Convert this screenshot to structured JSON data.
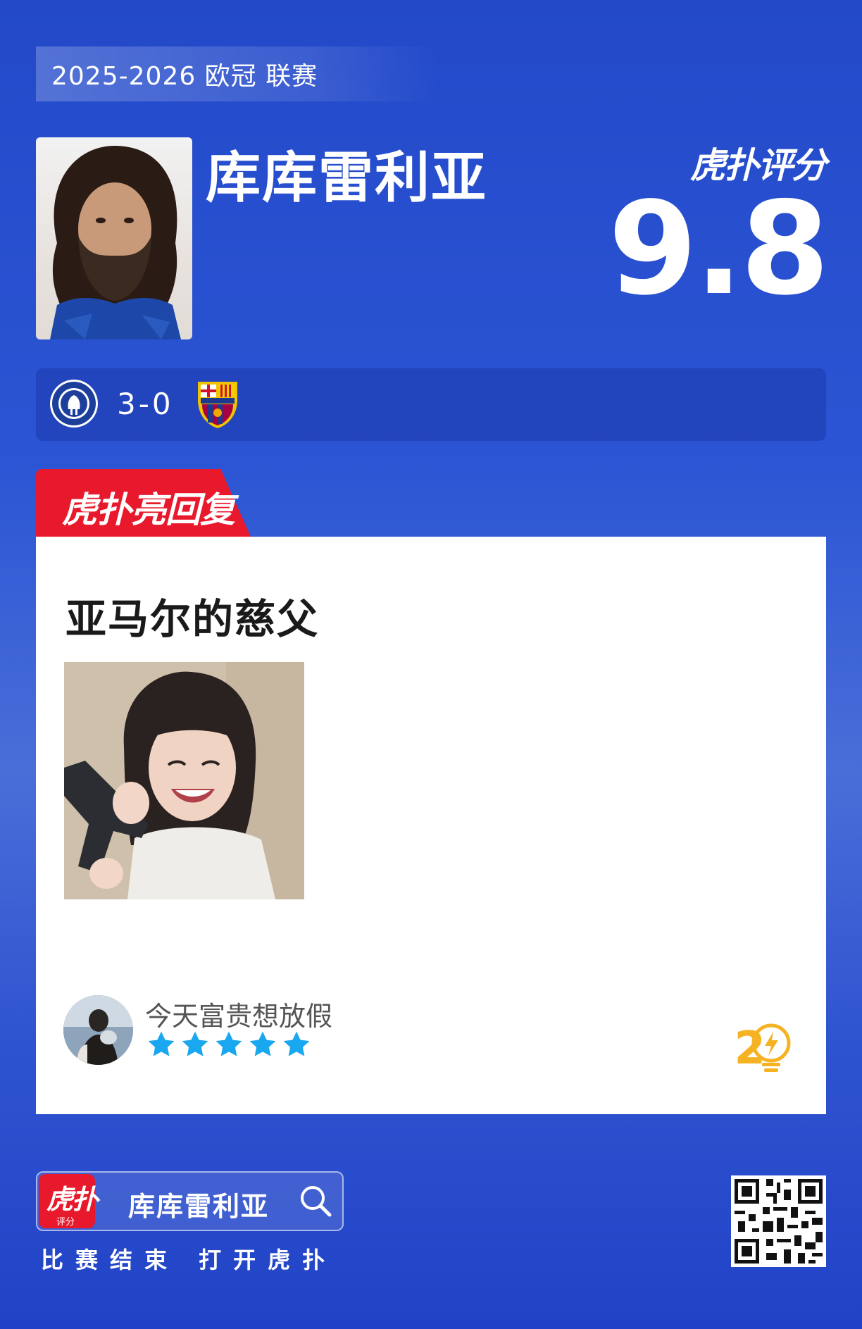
{
  "header": {
    "season_label": "2025-2026 欧冠 联赛"
  },
  "player": {
    "name": "库库雷利亚"
  },
  "rating": {
    "brand": "虎扑评分",
    "score": "9.8"
  },
  "match": {
    "score": "3-0",
    "home_team_icon": "chelsea-crest",
    "away_team_icon": "barcelona-crest"
  },
  "highlight_tag": {
    "label": "虎扑亮回复"
  },
  "reply": {
    "text": "亚马尔的慈父",
    "username": "今天富贵想放假",
    "stars": 5,
    "likes": "2",
    "star_color": "#19a7ef",
    "likes_color": "#f5b324"
  },
  "footer": {
    "app_logo_main": "虎扑",
    "app_logo_sub": "评分",
    "search_text": "库库雷利亚",
    "caption": "比赛结束 打开虎扑"
  },
  "colors": {
    "background": "#2a4fd0",
    "tag_red": "#e8192c",
    "card": "#ffffff"
  }
}
